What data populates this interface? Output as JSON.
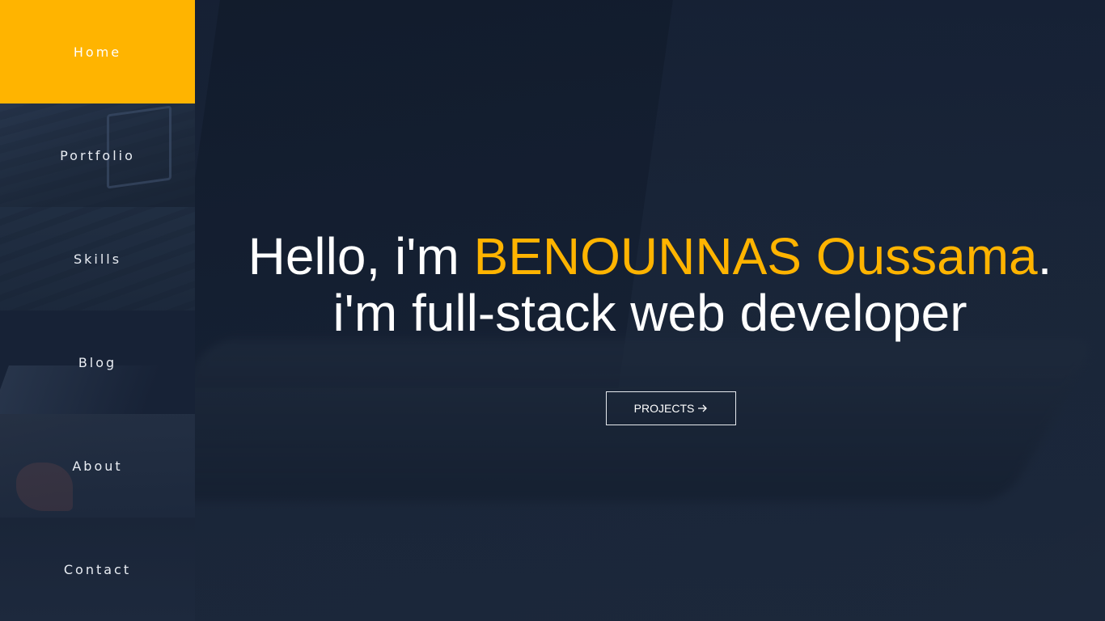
{
  "sidebar": {
    "items": [
      {
        "label": "Home",
        "active": true
      },
      {
        "label": "Portfolio",
        "active": false
      },
      {
        "label": "Skills",
        "active": false
      },
      {
        "label": "Blog",
        "active": false
      },
      {
        "label": "About",
        "active": false
      },
      {
        "label": "Contact",
        "active": false
      }
    ]
  },
  "hero": {
    "greeting": "Hello, i'm ",
    "name": "BENOUNNAS Oussama",
    "punct": ".",
    "role": "i'm full-stack web developer",
    "button_label": "PROJECTS",
    "button_icon": "arrow-right-icon"
  },
  "colors": {
    "accent": "#ffb400",
    "background": "#172236",
    "text": "#ffffff"
  }
}
